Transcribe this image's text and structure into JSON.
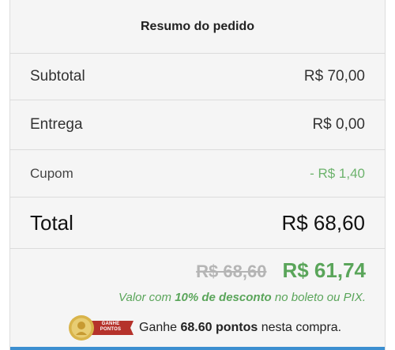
{
  "summary": {
    "title": "Resumo do pedido",
    "rows": [
      {
        "label": "Subtotal",
        "value": "R$ 70,00"
      },
      {
        "label": "Entrega",
        "value": "R$ 0,00"
      },
      {
        "label": "Cupom",
        "value": "- R$ 1,40"
      }
    ],
    "total_label": "Total",
    "total_value": "R$ 68,60"
  },
  "pix": {
    "old_price": "R$ 68,60",
    "new_price": "R$ 61,74",
    "note_prefix": "Valor com ",
    "note_discount": "10% de desconto",
    "note_suffix": " no boleto ou PIX."
  },
  "points": {
    "badge_label": "GANHE PONTOS",
    "text_prefix": "Ganhe ",
    "amount": "68.60 pontos",
    "text_suffix": " nesta compra."
  },
  "colors": {
    "green": "#5aa55a",
    "badge_red": "#b5322b",
    "badge_gold": "#d9b44a"
  }
}
